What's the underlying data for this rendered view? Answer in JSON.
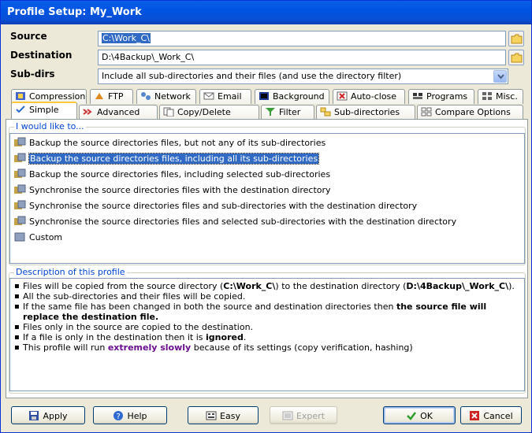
{
  "window": {
    "title": "Profile Setup: My_Work"
  },
  "form": {
    "source_label": "Source",
    "source_value": "C:\\Work_C\\",
    "destination_label": "Destination",
    "destination_value": "D:\\4Backup\\_Work_C\\",
    "subdirs_label": "Sub-dirs",
    "subdirs_value": "Include all sub-directories and their files (and use the directory filter)"
  },
  "tabs_row1": [
    {
      "label": "Compression",
      "icon": "compression-icon"
    },
    {
      "label": "FTP",
      "icon": "ftp-icon"
    },
    {
      "label": "Network",
      "icon": "network-icon"
    },
    {
      "label": "Email",
      "icon": "email-icon"
    },
    {
      "label": "Background",
      "icon": "background-icon"
    },
    {
      "label": "Auto-close",
      "icon": "auto-close-icon"
    },
    {
      "label": "Programs",
      "icon": "programs-icon"
    },
    {
      "label": "Misc.",
      "icon": "misc-icon"
    }
  ],
  "tabs_row2": [
    {
      "label": "Simple",
      "icon": "simple-icon",
      "active": true
    },
    {
      "label": "Advanced",
      "icon": "advanced-icon"
    },
    {
      "label": "Copy/Delete",
      "icon": "copy-delete-icon"
    },
    {
      "label": "Filter",
      "icon": "filter-icon"
    },
    {
      "label": "Sub-directories",
      "icon": "sub-directories-icon"
    },
    {
      "label": "Compare Options",
      "icon": "compare-options-icon"
    }
  ],
  "options_group": {
    "title": "I would like to...",
    "items": [
      "Backup the source directories files, but not any of its sub-directories",
      "Backup the source directories files, including all its sub-directories",
      "Backup the source directories files, including selected sub-directories",
      "Synchronise the source directories files with the destination directory",
      "Synchronise the source directories files and sub-directories with the destination directory",
      "Synchronise the source directories files and selected sub-directories with the destination directory",
      "Custom"
    ],
    "selected_index": 1
  },
  "description": {
    "title": "Description of this profile",
    "line1_pre": "Files will be copied from the source directory (",
    "line1_src": "C:\\Work_C\\",
    "line1_mid": ") to the destination directory (",
    "line1_dst": "D:\\4Backup\\_Work_C\\",
    "line1_post": ").",
    "line2": "All the sub-directories and their files will be copied.",
    "line3_pre": "If the same file has been changed in both the source and destination directories then ",
    "line3_bold": "the source file will replace the destination file.",
    "line4": "Files only in the source are copied to the destination.",
    "line5_pre": "If a file is only in the destination then it is ",
    "line5_bold": "ignored",
    "line5_post": ".",
    "line6_pre": "This profile will run ",
    "line6_purple": "extremely slowly",
    "line6_post": " because of its settings (copy verification, hashing)"
  },
  "buttons": {
    "apply": "Apply",
    "help": "Help",
    "easy": "Easy",
    "expert": "Expert",
    "ok": "OK",
    "cancel": "Cancel"
  },
  "colors": {
    "title_bar": "#0054e3",
    "selection": "#316ac5",
    "group_label": "#0046d5",
    "warning_text": "#6a0d8f",
    "ok_check": "#2a9d2a",
    "cancel_x": "#cc2222"
  }
}
